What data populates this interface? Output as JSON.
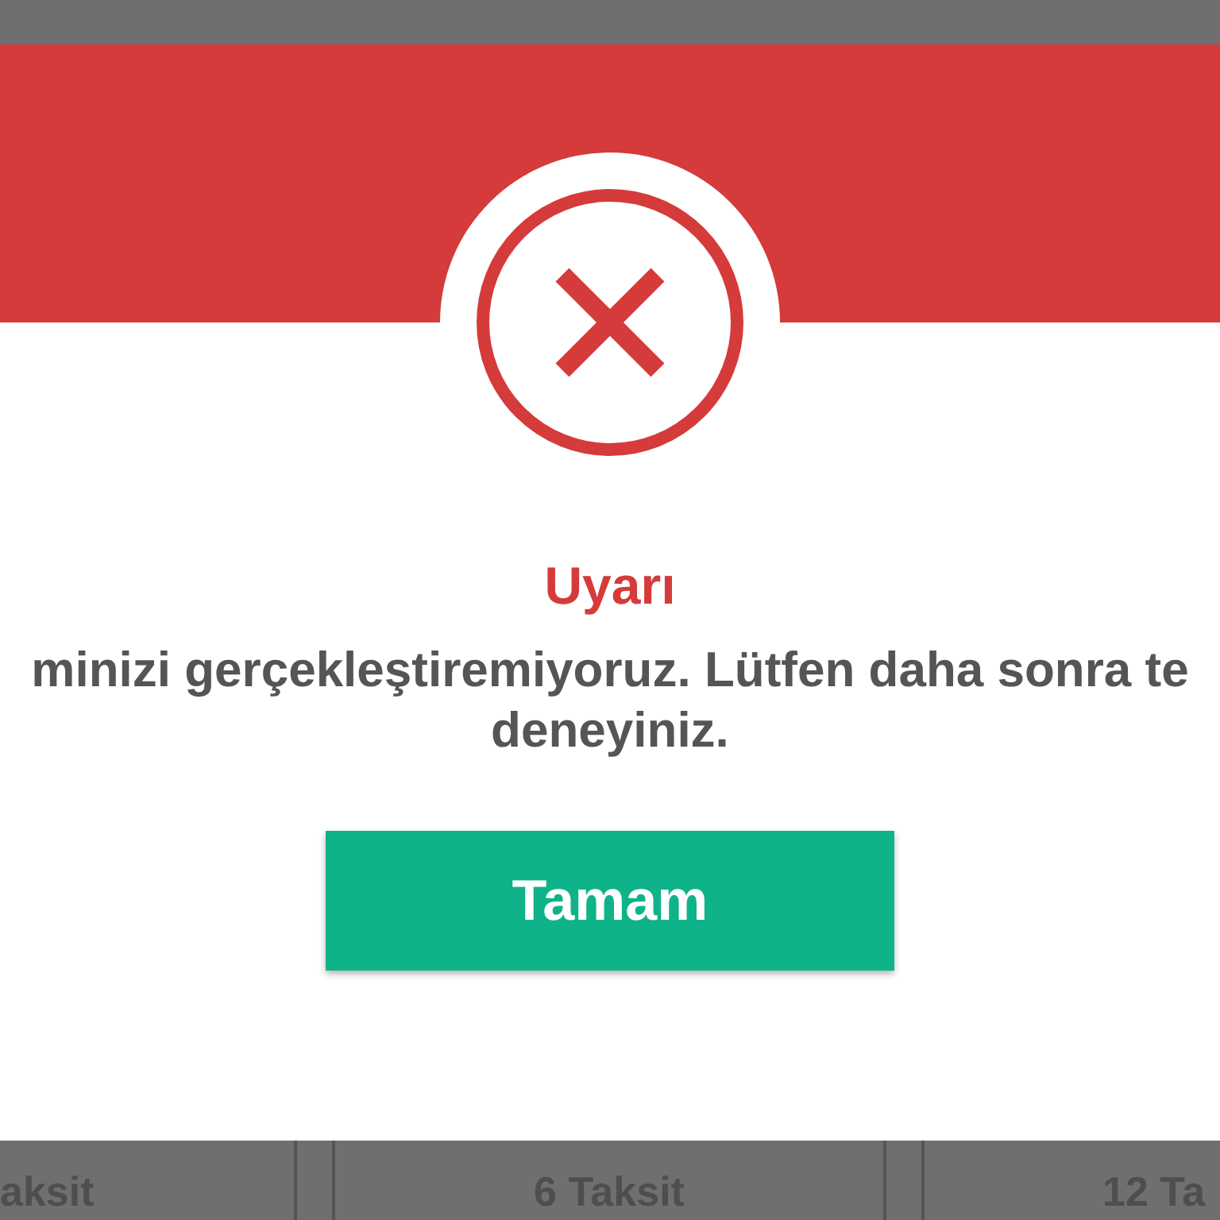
{
  "dialog": {
    "title": "Uyarı",
    "message_lines": [
      "minizi gerçekleştiremiyoruz. Lütfen daha sonra te",
      "deneyiniz."
    ],
    "button": "Tamam"
  },
  "tabs": [
    {
      "label": "aksit"
    },
    {
      "label": "6 Taksit"
    },
    {
      "label": "12 Ta"
    }
  ]
}
